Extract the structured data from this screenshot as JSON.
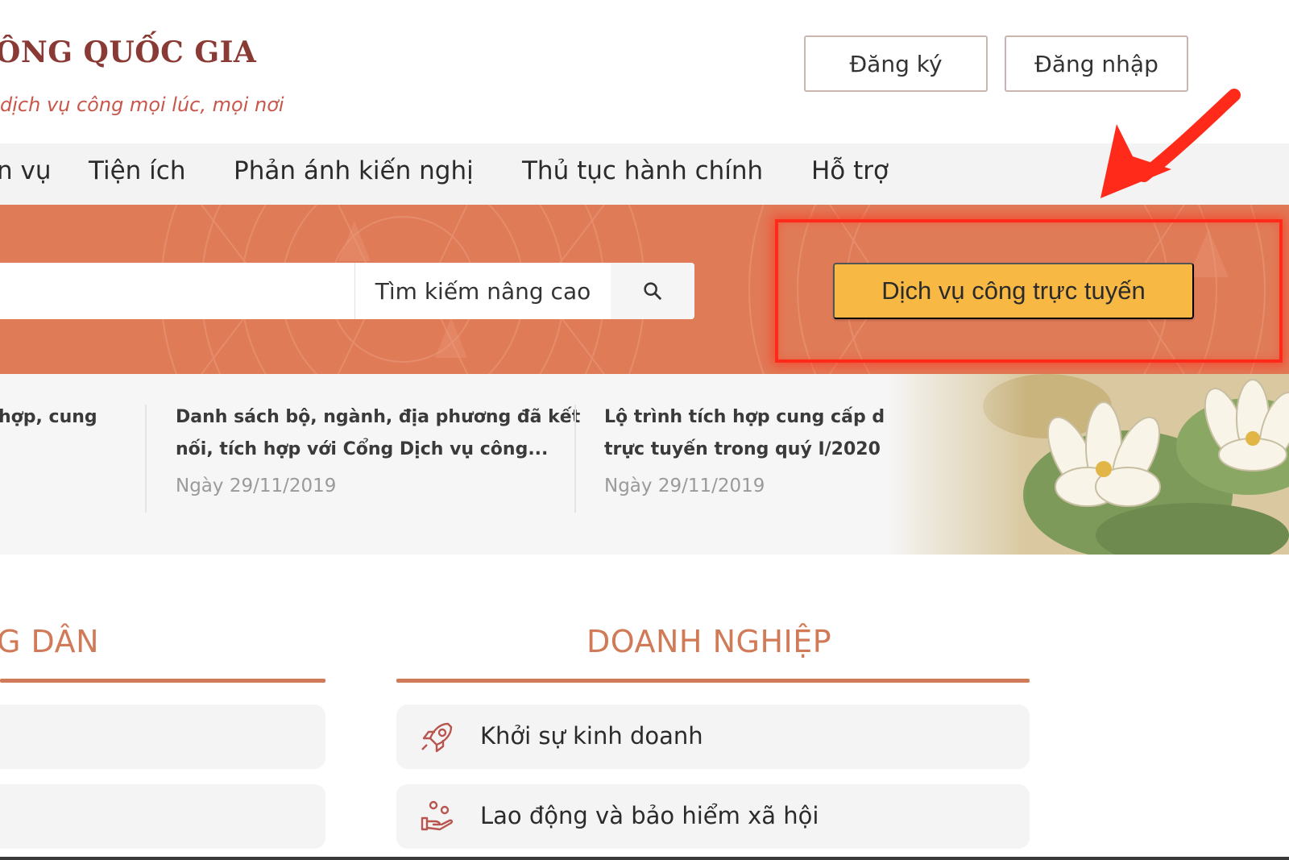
{
  "header": {
    "title": "ÔNG QUỐC GIA",
    "slogan": "dịch vụ công mọi lúc, mọi nơi",
    "register_label": "Đăng ký",
    "login_label": "Đăng nhập"
  },
  "nav": {
    "items": [
      {
        "label": "n vụ"
      },
      {
        "label": "Tiện ích"
      },
      {
        "label": "Phản ánh kiến nghị"
      },
      {
        "label": "Thủ tục hành chính"
      },
      {
        "label": "Hỗ trợ"
      }
    ]
  },
  "search": {
    "value": "",
    "advanced_label": "Tìm kiếm nâng cao",
    "icon": "search-icon"
  },
  "online_service": {
    "label": "Dịch vụ công trực tuyến",
    "highlight_color": "#ff2a1a",
    "button_color": "#f7b944"
  },
  "news": [
    {
      "title_1": "hợp, cung",
      "title_2": "",
      "date": ""
    },
    {
      "title_1": "Danh sách bộ, ngành, địa phương đã kết",
      "title_2": "nối, tích hợp với Cổng Dịch vụ công...",
      "date": "Ngày 29/11/2019"
    },
    {
      "title_1": "Lộ trình tích hợp cung cấp dịch vụ công",
      "title_2": "trực tuyến trong quý I/2020",
      "date": "Ngày 29/11/2019"
    }
  ],
  "sections": {
    "citizen": {
      "title": "G DÂN"
    },
    "business": {
      "title": "DOANH NGHIỆP",
      "items": [
        {
          "label": "Khởi sự kinh doanh",
          "icon": "rocket-icon"
        },
        {
          "label": "Lao động và bảo hiểm xã hội",
          "icon": "hand-people-icon"
        }
      ]
    }
  },
  "colors": {
    "banner": "#e07b58",
    "accent": "#cf7a58",
    "title": "#8a3a35"
  }
}
